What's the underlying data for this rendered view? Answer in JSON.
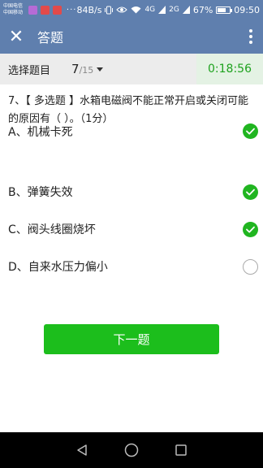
{
  "status_bar": {
    "carrier1": "中国电信",
    "carrier2": "中国移动",
    "dots": "···",
    "speed": "84B/s",
    "sig1": "4G",
    "sig2": "2G",
    "battery": "67%",
    "time": "09:50"
  },
  "app_bar": {
    "close_glyph": "✕",
    "title": "答题",
    "more_icon": "more-vertical-icon"
  },
  "selector": {
    "label": "选择题目",
    "current": "7",
    "separator": "/",
    "total": "15",
    "timer": "0:18:56"
  },
  "question": {
    "text": "7、【 多选题 】水箱电磁阀不能正常开启或关闭可能的原因有（ ）。（1分）"
  },
  "options": [
    {
      "label": "A、机械卡死",
      "checked": true
    },
    {
      "label": "B、弹簧失效",
      "checked": true
    },
    {
      "label": "C、阀头线圈烧坏",
      "checked": true
    },
    {
      "label": "D、自来水压力偏小",
      "checked": false
    }
  ],
  "next_button": {
    "label": "下一题"
  },
  "nav_bar": {
    "back": "back-triangle-icon",
    "home": "home-circle-icon",
    "recent": "recent-square-icon"
  },
  "colors": {
    "appbar": "#5f7fae",
    "accent_green": "#1cbe1c",
    "timer_bg": "#e4f2e4"
  }
}
